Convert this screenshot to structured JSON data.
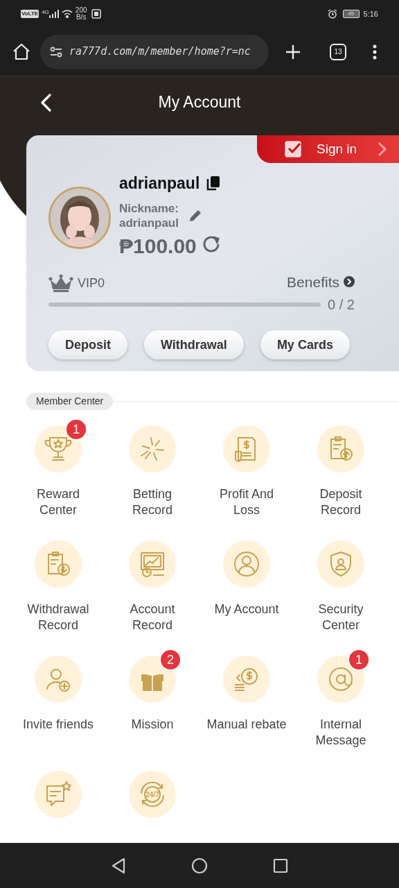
{
  "status_bar": {
    "network": "VoLTE",
    "signal": "4G",
    "speed_value": "200",
    "speed_unit": "B/s",
    "battery": "45",
    "time": "5:16"
  },
  "browser": {
    "url": "ra777d.com/m/member/home?r=nc",
    "tab_count": "13"
  },
  "header": {
    "title": "My Account"
  },
  "account_card": {
    "sign_in": "Sign in",
    "username": "adrianpaul",
    "nickname_label": "Nickname:",
    "nickname": "adrianpaul",
    "balance": "₱100.00",
    "vip": "VIP0",
    "benefits": "Benefits",
    "progress": {
      "level": 0,
      "reading": "0 / 2"
    },
    "buttons": [
      "Deposit",
      "Withdrawal",
      "My Cards"
    ]
  },
  "member_center": {
    "title": "Member Center",
    "items": [
      {
        "kind": "labeled",
        "label": "Reward Center",
        "badge": "1"
      },
      {
        "kind": "labeled",
        "label": "Betting Record"
      },
      {
        "kind": "labeled",
        "label": "Profit And Loss"
      },
      {
        "kind": "labeled",
        "label": "Deposit Record"
      },
      {
        "kind": "labeled",
        "label": "Withdrawal Record"
      },
      {
        "kind": "labeled",
        "label": "Account Record"
      },
      {
        "kind": "labeled",
        "label": "My Account"
      },
      {
        "kind": "labeled",
        "label": "Security Center"
      },
      {
        "kind": "labeled",
        "label": "Invite friends"
      },
      {
        "kind": "labeled",
        "label": "Mission",
        "badge": "2"
      },
      {
        "kind": "labeled",
        "label": "Manual rebate"
      },
      {
        "kind": "labeled",
        "label": "Internal Message",
        "badge": "1"
      },
      {
        "kind": "icon_only"
      },
      {
        "kind": "icon_only",
        "icon_text": "24/7"
      }
    ]
  }
}
